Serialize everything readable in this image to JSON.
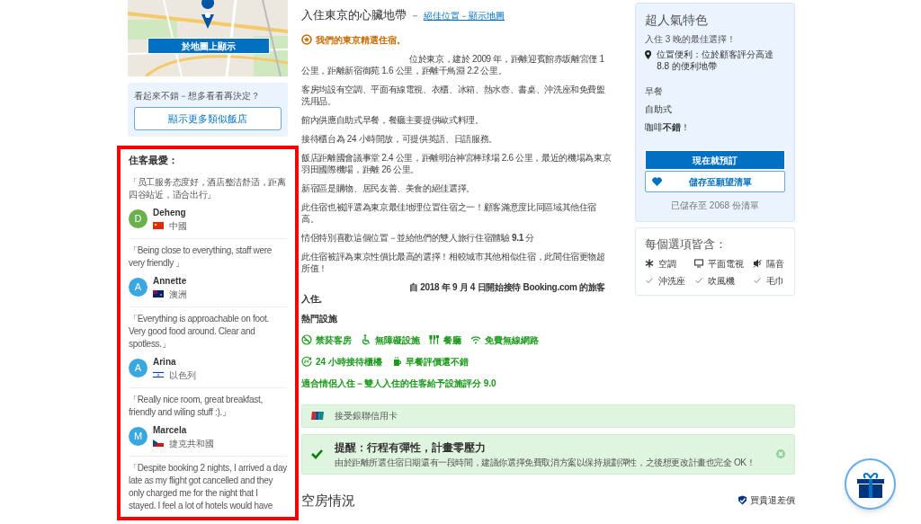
{
  "map": {
    "button": "於地圖上顯示"
  },
  "similar": {
    "prompt": "看起來不錯－想多看看再決定？",
    "button": "顯示更多類似飯店"
  },
  "guest_favorites": {
    "title": "住客最愛：",
    "reviews": [
      {
        "quote": "「员工服务态度好，酒店整洁舒适，距离四谷站近，适合出行」",
        "initial": "D",
        "name": "Deheng",
        "kind": "cn",
        "country": "中國",
        "color": "#6ab04c"
      },
      {
        "quote": "「Being close to everything, staff were very friendly 」",
        "initial": "A",
        "name": "Annette",
        "kind": "au",
        "country": "澳洲",
        "color": "#3aa7e0"
      },
      {
        "quote": "「Everything is approachable on foot. Very good food around. Clear and spotless.」",
        "initial": "A",
        "name": "Arina",
        "kind": "il",
        "country": "以色列",
        "color": "#3aa7e0"
      },
      {
        "quote": "「Really nice room, great breakfast, friendly and wiling stuff :).」",
        "initial": "M",
        "name": "Marcela",
        "kind": "cz",
        "country": "捷克共和國",
        "color": "#3aa7e0"
      },
      {
        "quote": "「Despite booking 2 nights, I arrived a day late as my flight got cancelled and they only charged me for the night that I stayed. I feel a lot of hotels would have"
      }
    ]
  },
  "headline": {
    "title": "入住東京的心臟地帶",
    "separator": "－",
    "link": "絕佳位置－顯示地圖"
  },
  "featured": "我們的東京精選住宿。",
  "paragraphs": [
    {
      "text": "位於東京，建於 2009 年，距離迎賓館赤坂離宮僅 1 公里，距離新宿御苑 1.6 公里，距離千鳥淵 2.2 公里。",
      "indent": true
    },
    {
      "text": "客房均設有空調、平面有線電視、衣櫃、冰箱、熱水壺、書桌、沖洗座和免費盥洗用品。",
      "indent": false
    },
    {
      "text": "館內供應自助式早餐，餐廳主要提供歐式料理。",
      "indent": false
    },
    {
      "text": "接待櫃台為 24 小時開放，可提供英語、日語服務。",
      "indent": false
    },
    {
      "text": "飯店距離國會議事堂 2.4 公里，距離明治神宮棒球場 2.6 公里，最近的機場為東京羽田國際機場，距離 26 公里。",
      "indent": false
    },
    {
      "text": "新宿區是購物、居民友善、美食的絕佳選擇。",
      "indent": false
    },
    {
      "text": "此住宿也被評選為東京最佳地理位置住宿之一！顧客滿意度比同區域其他住宿高。",
      "indent": false
    },
    {
      "text": "情侶特別喜歡這個位置－並給他們的雙人旅行住宿體驗 **9.1** 分",
      "indent": false
    },
    {
      "text": "此住宿被評為東京性價比最高的選擇！相較城市其他相似住宿，此間住宿更物超所值！",
      "indent": false
    }
  ],
  "since": "自 2018 年 9 月 4 日開始接待 Booking.com 的旅客入住。",
  "facilities": {
    "title": "熱門設施",
    "items": [
      {
        "label": "禁菸客房",
        "kind": "no-smoking"
      },
      {
        "label": "無障礙設施",
        "kind": "wheelchair"
      },
      {
        "label": "餐廳",
        "kind": "restaurant"
      },
      {
        "label": "免費無線網路",
        "kind": "wifi"
      },
      {
        "label": "24 小時接待櫃檯",
        "kind": "clock24"
      },
      {
        "label": "早餐評價還不錯",
        "kind": "coffee"
      }
    ]
  },
  "couples_note": "適合情侶入住－雙人入住的住客給予設施評分 9.0",
  "payment_notice": "接受銀聯信用卡",
  "reminder": {
    "title": "提醒：行程有彈性，計畫零壓力",
    "text": "由於距離所選住宿日期還有一段時間，建議你選擇免費取消方案以保持規劃彈性，之後想更改計畫也完全 OK！"
  },
  "availability": {
    "title": "空房情況",
    "price_match": "買貴退差價"
  },
  "highlights": {
    "title": "超人氣特色",
    "subtitle": "入住 3 晚的最佳選擇！",
    "location": "位置便利：位於顧客評分高達 8.8 的便利地帶",
    "breakfast_label": "早餐",
    "breakfast_type": "自助式",
    "coffee": "咖啡**不錯**！",
    "book_button": "現在就預訂",
    "save_button": "儲存至願望清單",
    "saved_count": "已儲存至 2068 份清單"
  },
  "included": {
    "title": "每個選項皆含：",
    "items": [
      {
        "label": "空調",
        "kind": "snowflake"
      },
      {
        "label": "平面電視",
        "kind": "tv"
      },
      {
        "label": "隔音",
        "kind": "soundproof"
      },
      {
        "label": "沖洗座",
        "kind": "check"
      },
      {
        "label": "吹風機",
        "kind": "check"
      },
      {
        "label": "毛巾",
        "kind": "check"
      }
    ]
  }
}
